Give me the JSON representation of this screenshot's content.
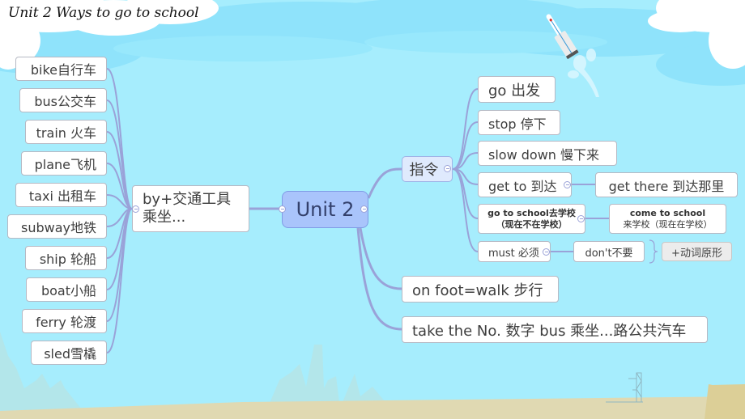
{
  "title": "Unit 2  Ways to go to school",
  "root": {
    "label": "Unit 2"
  },
  "transport": {
    "label_line1": "by+交通工具",
    "label_line2": "乘坐...",
    "items": [
      "bike自行车",
      "bus公交车",
      "train 火车",
      "plane飞机",
      "taxi 出租车",
      "subway地铁",
      "ship 轮船",
      "boat小船",
      "ferry 轮渡",
      "sled雪橇"
    ]
  },
  "commands": {
    "label": "指令",
    "items": [
      {
        "label": "go 出发"
      },
      {
        "label": "stop 停下"
      },
      {
        "label": "slow down 慢下来"
      },
      {
        "label": "get to 到达",
        "child": "get there 到达那里"
      },
      {
        "label_line1": "go to school去学校",
        "label_line2": "（现在不在学校）",
        "child_line1": "come to school",
        "child_line2": "来学校（现在在学校）"
      },
      {
        "label": "must 必须",
        "child": "don't不要",
        "note": "+动词原形"
      }
    ]
  },
  "on_foot": "on foot=walk 步行",
  "take_bus": "take the No. 数字 bus 乘坐...路公共汽车",
  "icons": {
    "collapse": "collapse-minus-icon",
    "rocket": "rocket-icon",
    "brace": "right-brace-icon"
  },
  "colors": {
    "sky": "#a6edfd",
    "root_fill": "#a9c4fb",
    "connector": "#9aa2d8",
    "sand": "#e0d9b2"
  }
}
